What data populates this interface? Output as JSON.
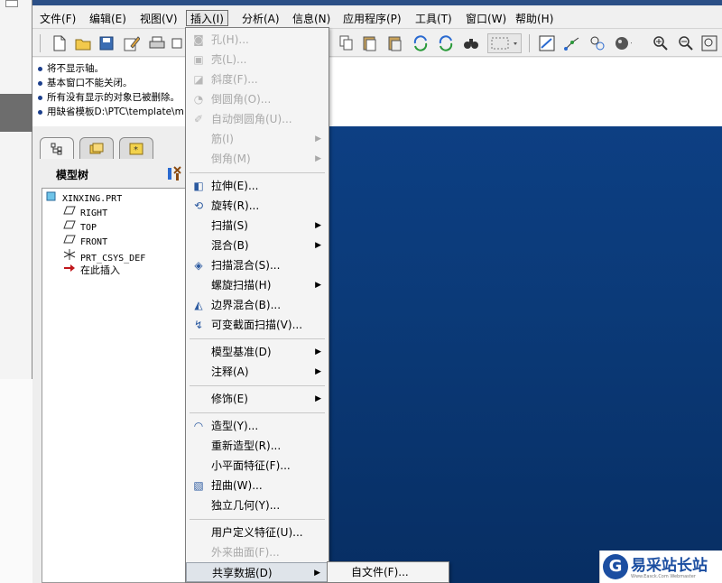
{
  "menubar": {
    "items": [
      "文件(F)",
      "编辑(E)",
      "视图(V)",
      "插入(I)",
      "分析(A)",
      "信息(N)",
      "应用程序(P)",
      "工具(T)",
      "窗口(W)",
      "帮助(H)"
    ]
  },
  "messages": [
    "将不显示轴。",
    "基本窗口不能关闭。",
    "所有没有显示的对象已被删除。",
    "用缺省模板D:\\PTC\\template\\m"
  ],
  "model_tree": {
    "title": "模型树",
    "nodes": [
      "XINXING.PRT",
      "RIGHT",
      "TOP",
      "FRONT",
      "PRT_CSYS_DEF",
      "在此插入"
    ]
  },
  "insert_menu": {
    "items": [
      {
        "label": "孔(H)...",
        "disabled": true
      },
      {
        "label": "壳(L)...",
        "disabled": true
      },
      {
        "label": "斜度(F)...",
        "disabled": true
      },
      {
        "label": "倒圆角(O)...",
        "disabled": true
      },
      {
        "label": "自动倒圆角(U)...",
        "disabled": true
      },
      {
        "label": "筋(I)",
        "disabled": true
      },
      {
        "label": "倒角(M)",
        "disabled": true
      },
      {
        "label": "拉伸(E)..."
      },
      {
        "label": "旋转(R)..."
      },
      {
        "label": "扫描(S)"
      },
      {
        "label": "混合(B)"
      },
      {
        "label": "扫描混合(S)..."
      },
      {
        "label": "螺旋扫描(H)"
      },
      {
        "label": "边界混合(B)..."
      },
      {
        "label": "可变截面扫描(V)..."
      },
      {
        "label": "模型基准(D)"
      },
      {
        "label": "注释(A)"
      },
      {
        "label": "修饰(E)"
      },
      {
        "label": "造型(Y)..."
      },
      {
        "label": "重新造型(R)..."
      },
      {
        "label": "小平面特征(F)..."
      },
      {
        "label": "扭曲(W)..."
      },
      {
        "label": "独立几何(Y)..."
      },
      {
        "label": "用户定义特征(U)..."
      },
      {
        "label": "外来曲面(F)...",
        "disabled": true
      },
      {
        "label": "共享数据(D)"
      }
    ]
  },
  "shared_data_submenu": {
    "item": "自文件(F)..."
  },
  "watermark": {
    "logo_letter": "G",
    "text": "易采站长站",
    "sub": "Www.Easck.Com Webmaster"
  },
  "colors": {
    "viewport_top": "#0d3f83",
    "viewport_bottom": "#072e63",
    "title_strip": "#2b4f86"
  }
}
